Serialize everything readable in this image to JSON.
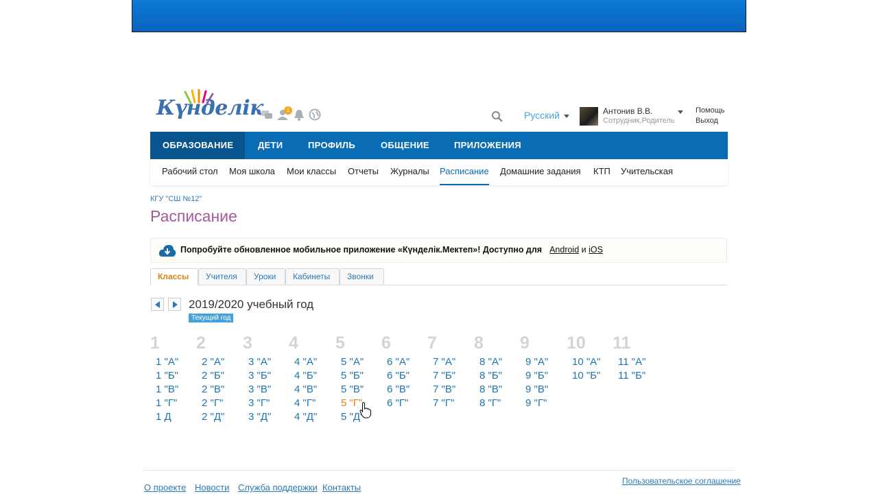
{
  "header": {
    "logo_text": "Күнделік",
    "notification_count": "1",
    "language": "Русский",
    "user_name": "Антонив В.В.",
    "user_role": "Сотрудник,Родитель",
    "help": "Помощь",
    "logout": "Выход"
  },
  "main_nav": [
    {
      "label": "ОБРАЗОВАНИЕ",
      "active": true
    },
    {
      "label": "ДЕТИ"
    },
    {
      "label": "ПРОФИЛЬ"
    },
    {
      "label": "ОБЩЕНИЕ"
    },
    {
      "label": "ПРИЛОЖЕНИЯ"
    }
  ],
  "sub_nav": [
    "Рабочий стол",
    "Моя школа",
    "Мои классы",
    "Отчеты",
    "Журналы",
    "Расписание",
    "Домашние задания",
    "КТП",
    "Учительская"
  ],
  "sub_nav_active": "Расписание",
  "breadcrumb": "КГУ \"СШ №12\"",
  "page_title": "Расписание",
  "banner": {
    "text": "Попробуйте обновленное мобильное приложение «Күнделік.Мектеп»! Доступно для",
    "android": "Android",
    "and": "и",
    "ios": "iOS"
  },
  "tabs": [
    "Классы",
    "Учителя",
    "Уроки",
    "Кабинеты",
    "Звонки"
  ],
  "active_tab": "Классы",
  "year": {
    "label": "2019/2020 учебный год",
    "current_badge": "Текущий год"
  },
  "grades": [
    {
      "num": "1",
      "classes": [
        "1 \"А\"",
        "1 \"Б\"",
        "1 \"В\"",
        "1 \"Г\"",
        "1 Д"
      ]
    },
    {
      "num": "2",
      "classes": [
        "2 \"А\"",
        "2 \"Б\"",
        "2 \"В\"",
        "2 \"Г\"",
        "2 \"Д\""
      ]
    },
    {
      "num": "3",
      "classes": [
        "3 \"А\"",
        "3 \"Б\"",
        "3 \"В\"",
        "3 \"Г\"",
        "3 \"Д\""
      ]
    },
    {
      "num": "4",
      "classes": [
        "4 \"А\"",
        "4 \"Б\"",
        "4 \"В\"",
        "4 \"Г\"",
        "4 \"Д\""
      ]
    },
    {
      "num": "5",
      "classes": [
        "5 \"А\"",
        "5 \"Б\"",
        "5 \"В\"",
        "5 \"Г\"",
        "5 \"Д\""
      ]
    },
    {
      "num": "6",
      "classes": [
        "6 \"А\"",
        "6 \"Б\"",
        "6 \"В\"",
        "6 \"Г\""
      ]
    },
    {
      "num": "7",
      "classes": [
        "7 \"А\"",
        "7 \"Б\"",
        "7 \"В\"",
        "7 \"Г\""
      ]
    },
    {
      "num": "8",
      "classes": [
        "8 \"А\"",
        "8 \"Б\"",
        "8 \"В\"",
        "8 \"Г\""
      ]
    },
    {
      "num": "9",
      "classes": [
        "9 \"А\"",
        "9 \"Б\"",
        "9 \"В\"",
        "9 \"Г\""
      ]
    },
    {
      "num": "10",
      "classes": [
        "10 \"А\"",
        "10 \"Б\""
      ]
    },
    {
      "num": "11",
      "classes": [
        "11 \"А\"",
        "11 \"Б\""
      ]
    }
  ],
  "hovered_class": "5 \"Г\"",
  "footer": {
    "links": [
      "О проекте",
      "Новости",
      "Служба поддержки",
      "Контакты"
    ],
    "agreement": "Пользовательское соглашение"
  },
  "colors": {
    "nav_blue": "#0a6db4",
    "nav_active": "#08548e",
    "link_blue": "#1e75ad",
    "accent_orange": "#e0820f",
    "title_purple": "#a45a9a"
  },
  "icons": [
    "chat-icon",
    "friends-icon",
    "bell-icon",
    "globe-icon",
    "search-icon",
    "download-cloud-icon",
    "arrow-left-icon",
    "arrow-right-icon",
    "hand-cursor-icon"
  ]
}
